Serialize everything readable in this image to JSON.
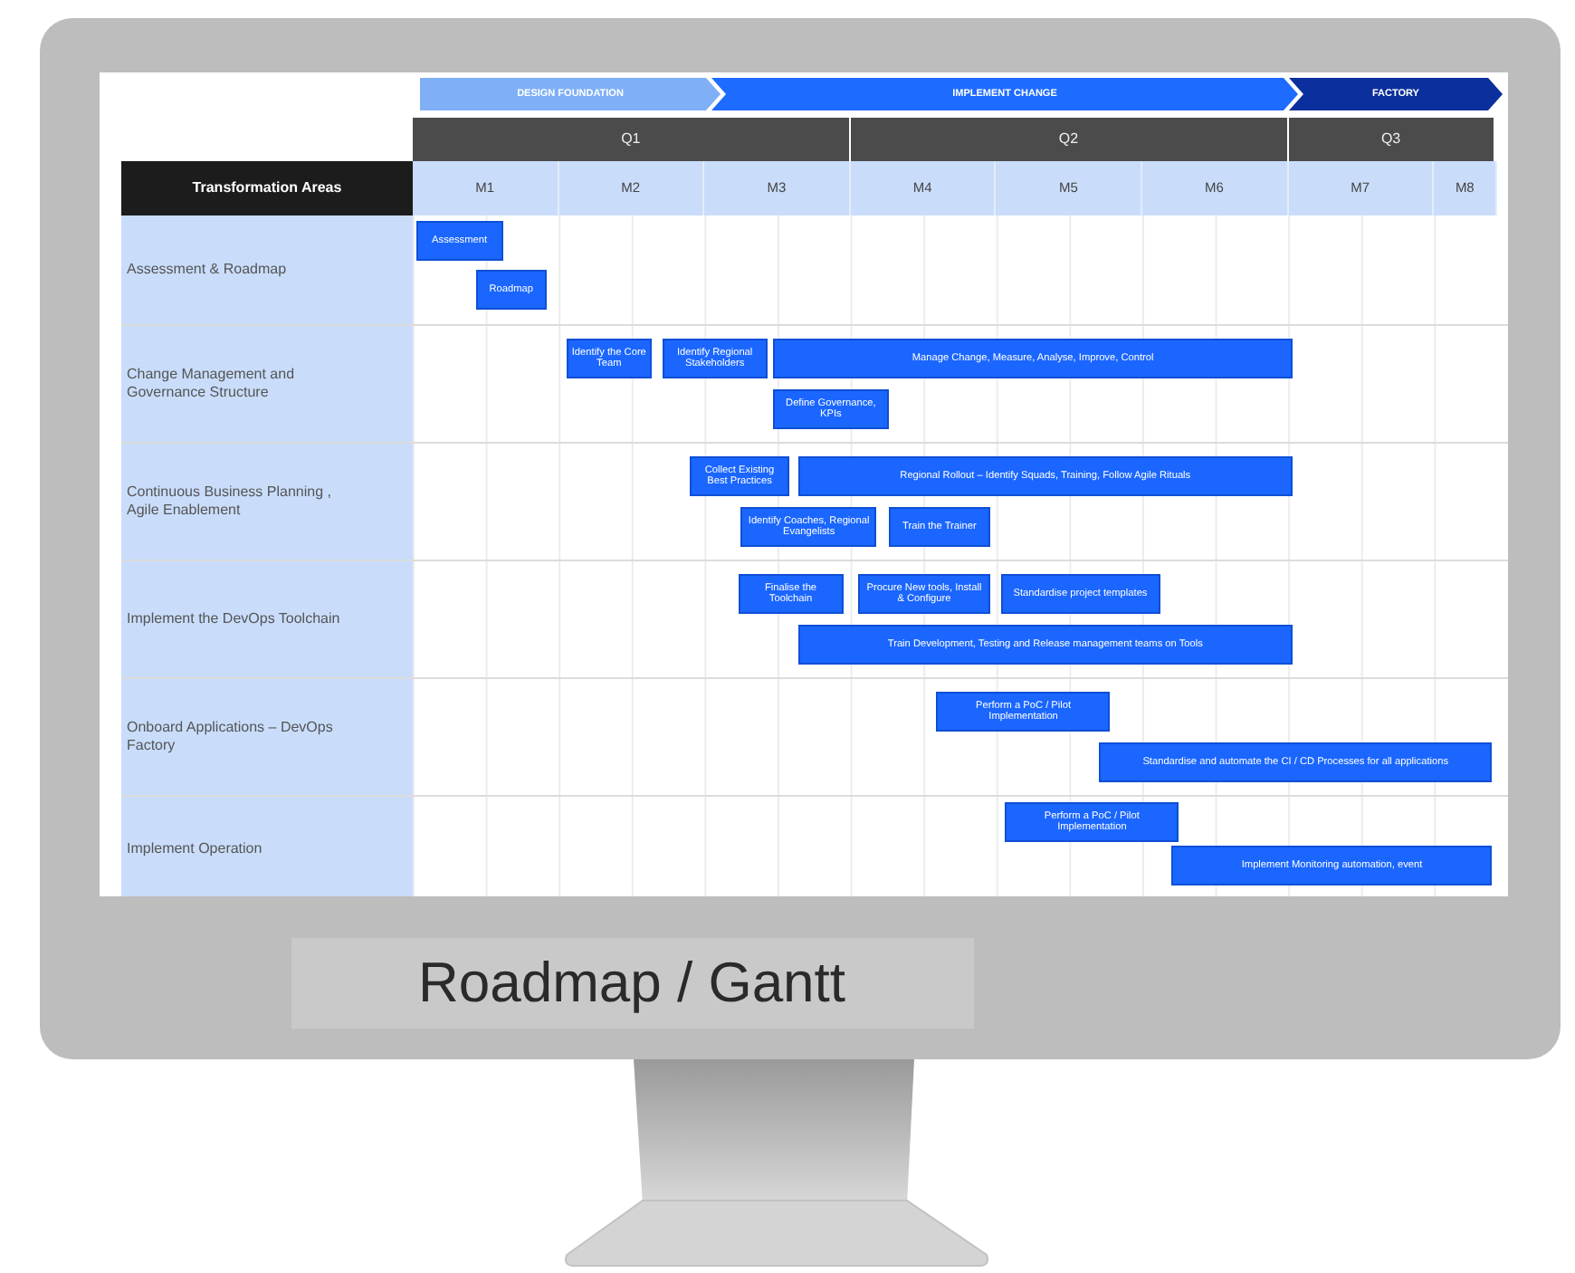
{
  "phases": [
    {
      "label": "DESIGN FOUNDATION",
      "color": "#7fb0f7"
    },
    {
      "label": "IMPLEMENT CHANGE",
      "color": "#1e6bff"
    },
    {
      "label": "FACTORY",
      "color": "#0b2f9c"
    }
  ],
  "quarters": [
    "Q1",
    "Q2",
    "Q3"
  ],
  "areas_header": "Transformation Areas",
  "months": [
    "M1",
    "M2",
    "M3",
    "M4",
    "M5",
    "M6",
    "M7",
    "M8"
  ],
  "areas": [
    {
      "label": "Assessment & Roadmap",
      "bars": [
        "Assessment",
        "Roadmap"
      ]
    },
    {
      "label": "Change Management and Governance Structure",
      "bars": [
        "Identify the Core Team",
        "Identify Regional Stakeholders",
        "Manage Change, Measure, Analyse, Improve, Control",
        "Define Governance, KPIs"
      ]
    },
    {
      "label": "Continuous Business Planning , Agile Enablement",
      "bars": [
        "Collect Existing Best Practices",
        "Regional Rollout – Identify Squads, Training, Follow Agile Rituals",
        "Identify Coaches, Regional Evangelists",
        "Train the Trainer"
      ]
    },
    {
      "label": "Implement the DevOps Toolchain",
      "bars": [
        "Finalise the Toolchain",
        "Procure New tools, Install & Configure",
        "Standardise project templates",
        "Train Development, Testing and Release management teams on Tools"
      ]
    },
    {
      "label": "Onboard Applications – DevOps Factory",
      "bars": [
        "Perform a PoC / Pilot Implementation",
        "Standardise and automate the CI / CD Processes for all applications"
      ]
    },
    {
      "label": "Implement Operation",
      "bars": [
        "Perform a PoC / Pilot Implementation",
        "Implement Monitoring automation, event"
      ]
    }
  ],
  "caption": "Roadmap / Gantt"
}
